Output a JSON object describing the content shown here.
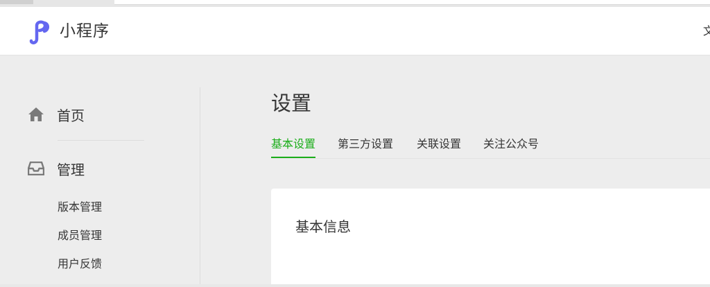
{
  "header": {
    "app_title": "小程序",
    "right_text": "文",
    "brand_color": "#6467f0"
  },
  "sidebar": {
    "items": [
      {
        "label": "首页",
        "icon": "home-icon"
      },
      {
        "label": "管理",
        "icon": "inbox-icon"
      }
    ],
    "sub_items": [
      {
        "label": "版本管理"
      },
      {
        "label": "成员管理"
      },
      {
        "label": "用户反馈"
      }
    ]
  },
  "main": {
    "page_title": "设置",
    "tabs": [
      {
        "label": "基本设置",
        "active": true
      },
      {
        "label": "第三方设置"
      },
      {
        "label": "关联设置"
      },
      {
        "label": "关注公众号"
      }
    ],
    "card_title": "基本信息",
    "accent_color": "#1aad19"
  }
}
